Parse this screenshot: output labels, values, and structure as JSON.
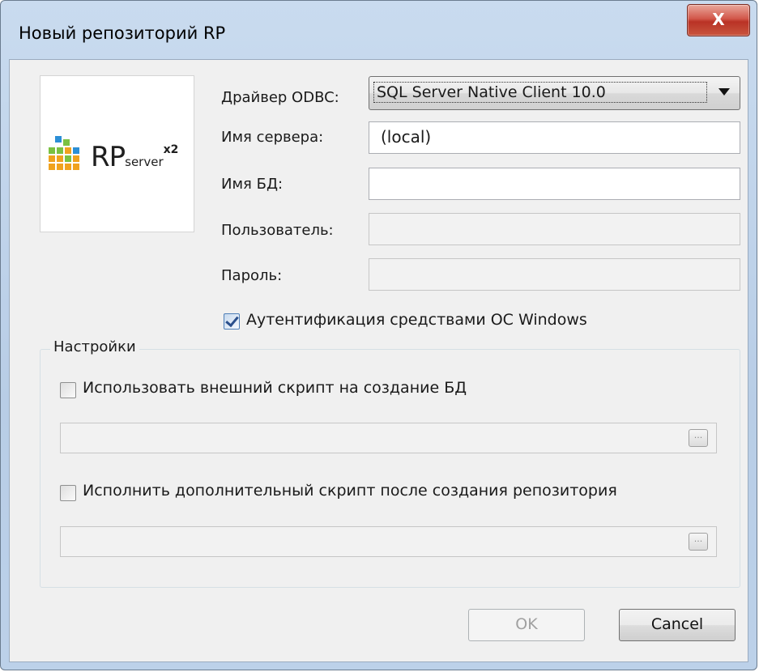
{
  "window": {
    "title": "Новый репозиторий RP",
    "close_glyph": "X"
  },
  "logo": {
    "rp": "RP",
    "server": "server",
    "x2": "x2"
  },
  "form": {
    "driver_label": "Драйвер ODBC:",
    "driver_value": "SQL Server Native Client 10.0",
    "server_label": "Имя сервера:",
    "server_value": "(local)",
    "db_label": "Имя БД:",
    "db_value": "",
    "user_label": "Пользователь:",
    "user_value": "",
    "password_label": "Пароль:",
    "password_value": "",
    "windows_auth_label": "Аутентификация средствами ОС Windows",
    "windows_auth_checked": true
  },
  "settings": {
    "title": "Настройки",
    "external_script_label": "Использовать внешний скрипт на создание БД",
    "external_script_checked": false,
    "external_script_path": "",
    "extra_script_label": "Исполнить дополнительный скрипт после создания репозитория",
    "extra_script_checked": false,
    "extra_script_path": "",
    "browse_label": "..."
  },
  "buttons": {
    "ok": "OK",
    "cancel": "Cancel"
  },
  "icons": [
    "close-icon",
    "dropdown-arrow-icon",
    "checkmark-icon",
    "browse-icon",
    "rp-logo-icon"
  ]
}
